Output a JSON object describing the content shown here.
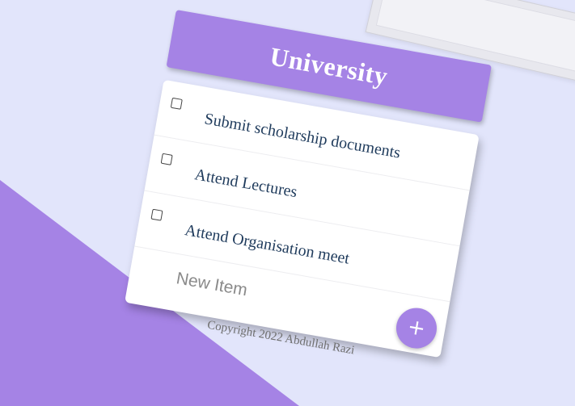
{
  "heading": {
    "title": "University"
  },
  "todo": {
    "items": [
      {
        "label": "Submit scholarship documents",
        "checked": false
      },
      {
        "label": "Attend Lectures",
        "checked": false
      },
      {
        "label": "Attend Organisation meet",
        "checked": false
      }
    ],
    "new_item": {
      "value": "",
      "placeholder": "New Item"
    },
    "add_button": {
      "label": "+"
    }
  },
  "footer": {
    "text": "Copyright 2022 Abdullah Razi"
  },
  "colors": {
    "accent": "#a583e5",
    "background": "#e2e5fb",
    "item_text": "#1f3b5c"
  }
}
